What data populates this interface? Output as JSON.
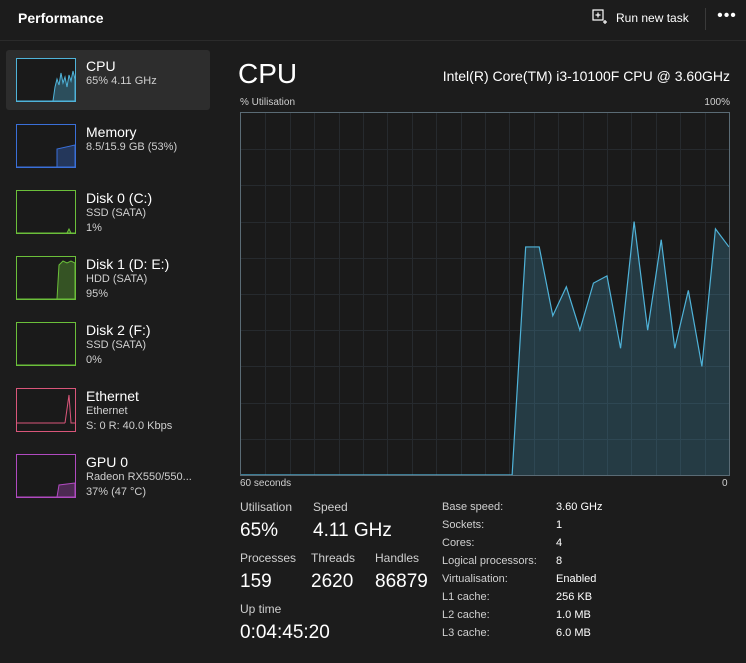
{
  "header": {
    "title": "Performance",
    "run_task_label": "Run new task",
    "more_label": "•••"
  },
  "sidebar": {
    "items": [
      {
        "name": "CPU",
        "sub1": "65% 4.11 GHz",
        "sub2": "",
        "sub3": "",
        "color": "#4fb3d9",
        "active": true
      },
      {
        "name": "Memory",
        "sub1": "8.5/15.9 GB (53%)",
        "sub2": "",
        "sub3": "",
        "color": "#3a6fd8",
        "active": false
      },
      {
        "name": "Disk 0 (C:)",
        "sub1": "SSD (SATA)",
        "sub2": "1%",
        "sub3": "",
        "color": "#6bbf3a",
        "active": false
      },
      {
        "name": "Disk 1 (D: E:)",
        "sub1": "HDD (SATA)",
        "sub2": "95%",
        "sub3": "",
        "color": "#6bbf3a",
        "active": false
      },
      {
        "name": "Disk 2 (F:)",
        "sub1": "SSD (SATA)",
        "sub2": "0%",
        "sub3": "",
        "color": "#6bbf3a",
        "active": false
      },
      {
        "name": "Ethernet",
        "sub1": "Ethernet",
        "sub2": "S: 0 R: 40.0 Kbps",
        "sub3": "",
        "color": "#d9567a",
        "active": false
      },
      {
        "name": "GPU 0",
        "sub1": "Radeon RX550/550...",
        "sub2": "37% (47 °C)",
        "sub3": "",
        "color": "#b04ac0",
        "active": false
      }
    ]
  },
  "main": {
    "title": "CPU",
    "model": "Intel(R) Core(TM) i3-10100F CPU @ 3.60GHz",
    "util_label": "% Utilisation",
    "max_label": "100%",
    "time_label": "60 seconds",
    "zero_label": "0",
    "accent": "#4fb3d9"
  },
  "stats": {
    "utilisation_label": "Utilisation",
    "utilisation": "65%",
    "speed_label": "Speed",
    "speed": "4.11 GHz",
    "processes_label": "Processes",
    "processes": "159",
    "threads_label": "Threads",
    "threads": "2620",
    "handles_label": "Handles",
    "handles": "86879",
    "uptime_label": "Up time",
    "uptime": "0:04:45:20"
  },
  "info": [
    {
      "key": "Base speed:",
      "value": "3.60 GHz"
    },
    {
      "key": "Sockets:",
      "value": "1"
    },
    {
      "key": "Cores:",
      "value": "4"
    },
    {
      "key": "Logical processors:",
      "value": "8"
    },
    {
      "key": "Virtualisation:",
      "value": "Enabled"
    },
    {
      "key": "L1 cache:",
      "value": "256 KB"
    },
    {
      "key": "L2 cache:",
      "value": "1.0 MB"
    },
    {
      "key": "L3 cache:",
      "value": "6.0 MB"
    }
  ],
  "chart_data": {
    "type": "area",
    "x": [
      0,
      2,
      4,
      6,
      8,
      10,
      12,
      14,
      16,
      18,
      20,
      22,
      24,
      26,
      28,
      30,
      32,
      34,
      36,
      38,
      39,
      40,
      42,
      44,
      46,
      48,
      50,
      52,
      54,
      56,
      58,
      60
    ],
    "values": [
      0,
      0,
      0,
      0,
      0,
      0,
      0,
      0,
      0,
      0,
      0,
      0,
      0,
      0,
      0,
      0,
      0,
      0,
      0,
      0,
      0,
      60,
      60,
      50,
      43,
      47,
      38,
      51,
      55,
      52,
      44,
      48
    ],
    "series_values": [
      0,
      0,
      0,
      0,
      0,
      0,
      0,
      0,
      0,
      0,
      0,
      0,
      0,
      0,
      0,
      0,
      0,
      0,
      0,
      0,
      0,
      63,
      63,
      44,
      52,
      40,
      53,
      55,
      35,
      70,
      40,
      65,
      35,
      51,
      30,
      68,
      63
    ],
    "ylim": [
      0,
      100
    ],
    "xlim": [
      0,
      60
    ],
    "grid": true
  }
}
